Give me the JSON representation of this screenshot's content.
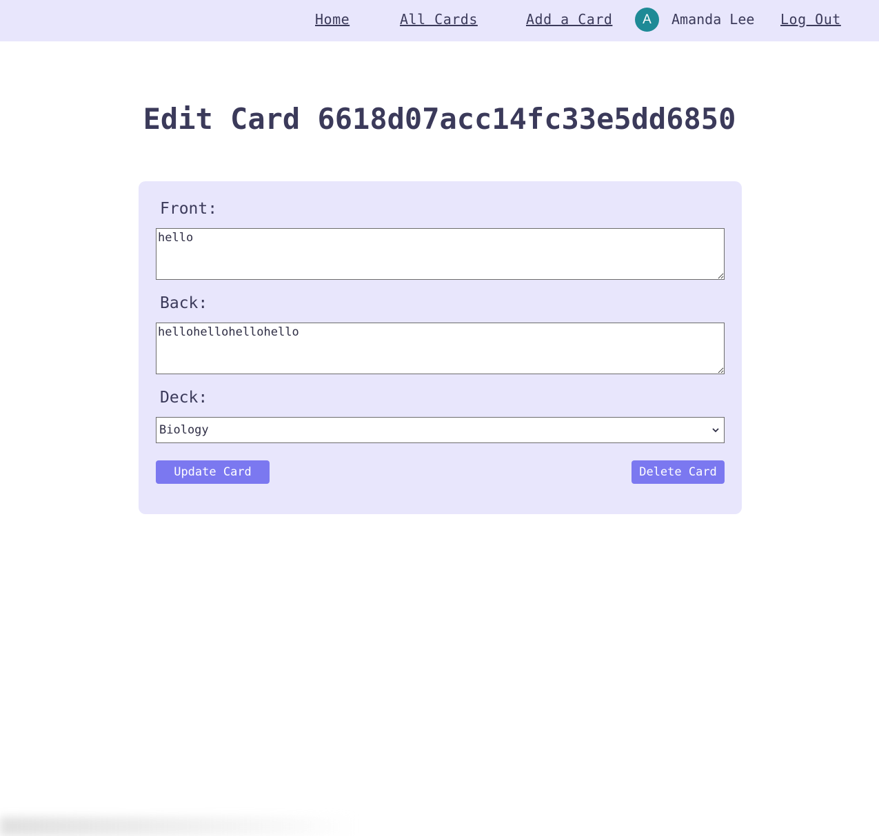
{
  "nav": {
    "home": "Home",
    "all_cards": "All Cards",
    "add_card": "Add a Card",
    "avatar_initial": "A",
    "user_name": "Amanda Lee",
    "log_out": "Log Out"
  },
  "page": {
    "title": "Edit Card 6618d07acc14fc33e5dd6850"
  },
  "form": {
    "front_label": "Front:",
    "front_value": "hello",
    "back_label": "Back:",
    "back_value": "hellohellohellohello",
    "deck_label": "Deck:",
    "deck_selected": "Biology",
    "update_button": "Update Card",
    "delete_button": "Delete Card"
  },
  "colors": {
    "nav_bg": "#e8e6fc",
    "card_bg": "#e8e6fc",
    "avatar_bg": "#1e8a96",
    "button_bg": "#7b78f0",
    "text": "#3b3a5a"
  },
  "icons": {
    "dropdown": "chevron-down-icon",
    "resize": "resize-grip-icon"
  }
}
